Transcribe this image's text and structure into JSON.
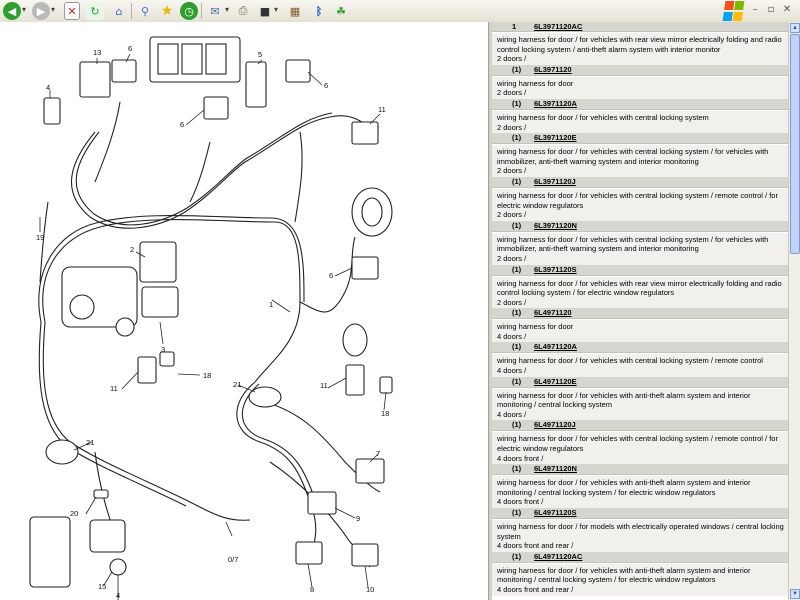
{
  "toolbar": {
    "buttons": [
      {
        "name": "back-button",
        "icon": "back-arrow-icon",
        "color": "#2e9e2e"
      },
      {
        "name": "forward-button",
        "icon": "forward-arrow-icon",
        "color": "#9a9a9a"
      },
      {
        "name": "stop-button",
        "icon": "stop-icon",
        "color": "#d32020"
      },
      {
        "name": "refresh-button",
        "icon": "refresh-icon",
        "color": "#2e9e2e"
      },
      {
        "name": "home-button",
        "icon": "home-icon",
        "color": "#3a6fc9"
      },
      {
        "name": "search-button",
        "icon": "search-icon",
        "color": "#3a6fc9"
      },
      {
        "name": "favorites-button",
        "icon": "star-icon",
        "color": "#e6b800"
      },
      {
        "name": "history-button",
        "icon": "history-icon",
        "color": "#2e9e2e"
      },
      {
        "name": "mail-button",
        "icon": "mail-icon",
        "color": "#4a6aa8"
      },
      {
        "name": "print-button",
        "icon": "printer-icon",
        "color": "#666666"
      },
      {
        "name": "edit-button",
        "icon": "edit-icon",
        "color": "#333333"
      },
      {
        "name": "research-button",
        "icon": "research-icon",
        "color": "#7a5c2a"
      },
      {
        "name": "bluetooth-button",
        "icon": "bluetooth-icon",
        "color": "#1f5ec7"
      },
      {
        "name": "messenger-button",
        "icon": "messenger-icon",
        "color": "#2e9e2e"
      }
    ]
  },
  "diagram": {
    "labels": [
      "13",
      "6",
      "5",
      "6",
      "4",
      "11",
      "6",
      "19",
      "2",
      "6",
      "1",
      "3",
      "18",
      "11",
      "21",
      "11",
      "18",
      "21",
      "7",
      "20",
      "9",
      "0/7",
      "15",
      "4",
      "8",
      "10"
    ]
  },
  "parts_list": {
    "top_fragment": {
      "qty": "1",
      "part": "6L3971120AC"
    },
    "entries": [
      {
        "desc": [
          "wiring harness for door / for vehicles with rear view mirror electrically folding and radio control locking system / anti-theft alarm system with interior monitor",
          "2 doors /"
        ],
        "qty": "(1)",
        "part": "6L3971120"
      },
      {
        "desc": [
          "wiring harness for door",
          "2 doors /"
        ],
        "qty": "(1)",
        "part": "6L3971120A"
      },
      {
        "desc": [
          "wiring harness for door / for vehicles with central locking system",
          "2 doors /"
        ],
        "qty": "(1)",
        "part": "6L3971120E"
      },
      {
        "desc": [
          "wiring harness for door / for vehicles with central locking system / for vehicles with immobilizer, anti-theft warning system and interior monitoring",
          "2 doors /"
        ],
        "qty": "(1)",
        "part": "6L3971120J"
      },
      {
        "desc": [
          "wiring harness for door / for vehicles with central locking system / remote control / for electric window regulators",
          "2 doors /"
        ],
        "qty": "(1)",
        "part": "6L3971120N"
      },
      {
        "desc": [
          "wiring harness for door / for vehicles with central locking system / for vehicles with immobilizer, anti-theft warning system and interior monitoring",
          "2 doors /"
        ],
        "qty": "(1)",
        "part": "6L3971120S"
      },
      {
        "desc": [
          "wiring harness for door / for vehicles with rear view mirror electrically folding and radio control locking system / for electric window regulators",
          "2 doors /"
        ],
        "qty": "(1)",
        "part": "6L4971120"
      },
      {
        "desc": [
          "wiring harness for door",
          "4 doors /"
        ],
        "qty": "(1)",
        "part": "6L4971120A"
      },
      {
        "desc": [
          "wiring harness for door / for vehicles with central locking system / remote control",
          "4 doors /"
        ],
        "qty": "(1)",
        "part": "6L4971120E"
      },
      {
        "desc": [
          "wiring harness for door / for vehicles with anti-theft alarm system and interior monitoring / central locking system",
          "4 doors /"
        ],
        "qty": "(1)",
        "part": "6L4971120J"
      },
      {
        "desc": [
          "wiring harness for door / for vehicles with central locking system / remote control / for electric window regulators",
          "4 doors front /"
        ],
        "qty": "(1)",
        "part": "6L4971120N"
      },
      {
        "desc": [
          "wiring harness for door / for vehicles with anti-theft alarm system and interior monitoring / central locking system / for electric window regulators",
          "4 doors front /"
        ],
        "qty": "(1)",
        "part": "6L4971120S"
      },
      {
        "desc": [
          "wiring harness for door / for models with electrically operated windows / central locking system",
          "4 doors front and rear /"
        ],
        "qty": "(1)",
        "part": "6L4971120AC"
      },
      {
        "desc": [
          "wiring harness for door / for vehicles with anti-theft alarm system and interior monitoring / central locking system / for electric window regulators",
          "4 doors front and rear /"
        ],
        "qty": "",
        "part": ""
      }
    ]
  }
}
